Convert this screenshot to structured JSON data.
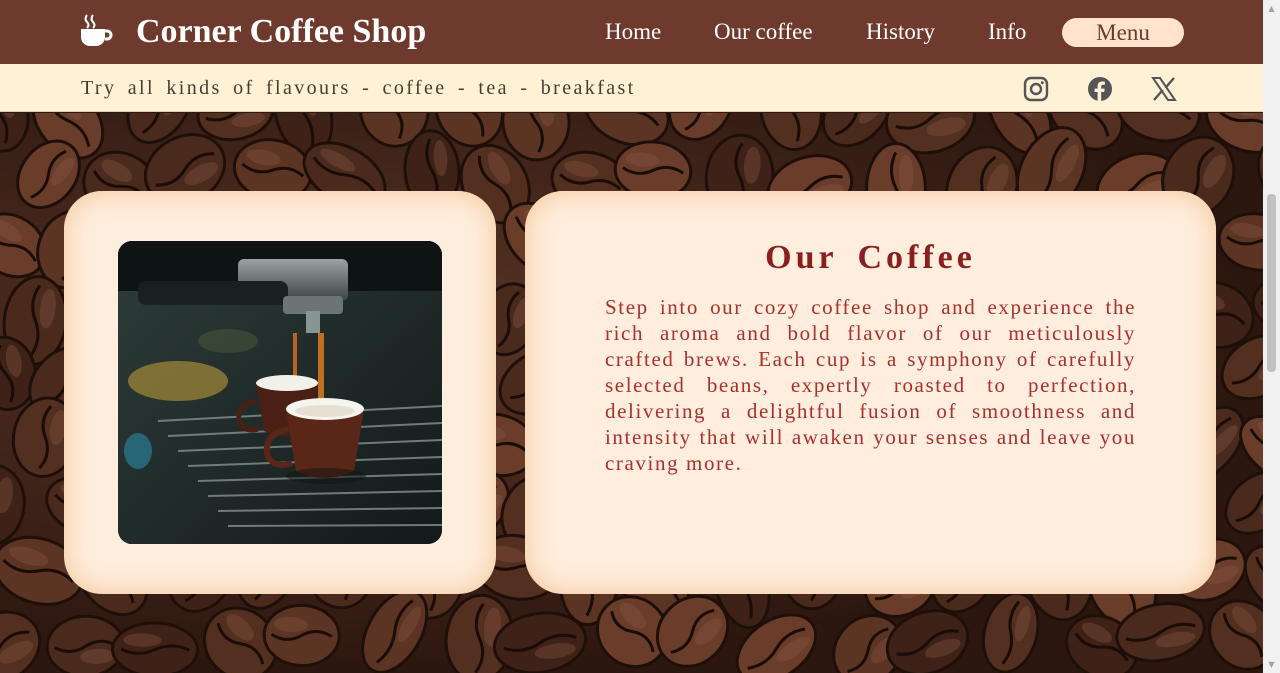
{
  "header": {
    "brand": "Corner Coffee Shop",
    "logo_icon": "coffee-cup-icon",
    "nav": [
      {
        "label": "Home"
      },
      {
        "label": "Our coffee"
      },
      {
        "label": "History"
      },
      {
        "label": "Info"
      }
    ],
    "menu_label": "Menu"
  },
  "strip": {
    "tagline": "Try all kinds of flavours - coffee - tea - breakfast",
    "social": [
      "instagram-icon",
      "facebook-icon",
      "x-icon"
    ]
  },
  "cards": {
    "photo": {
      "subject": "espresso-machine-photo"
    },
    "text": {
      "title": "Our Coffee",
      "body": "Step into our cozy coffee shop and experience the rich aroma and bold flavor of our meticulously crafted brews. Each cup is a symphony of carefully selected beans, expertly roasted to perfection, delivering a delightful fusion of smoothness and intensity that will awaken your senses and leave you craving more."
    }
  },
  "colors": {
    "header_bg": "#6e3a2e",
    "strip_bg": "#fff1d6",
    "card_bg": "#ffeedd",
    "title_color": "#8a1f1f",
    "body_color": "#a8302e",
    "menu_button_bg": "#ffe3cf"
  }
}
